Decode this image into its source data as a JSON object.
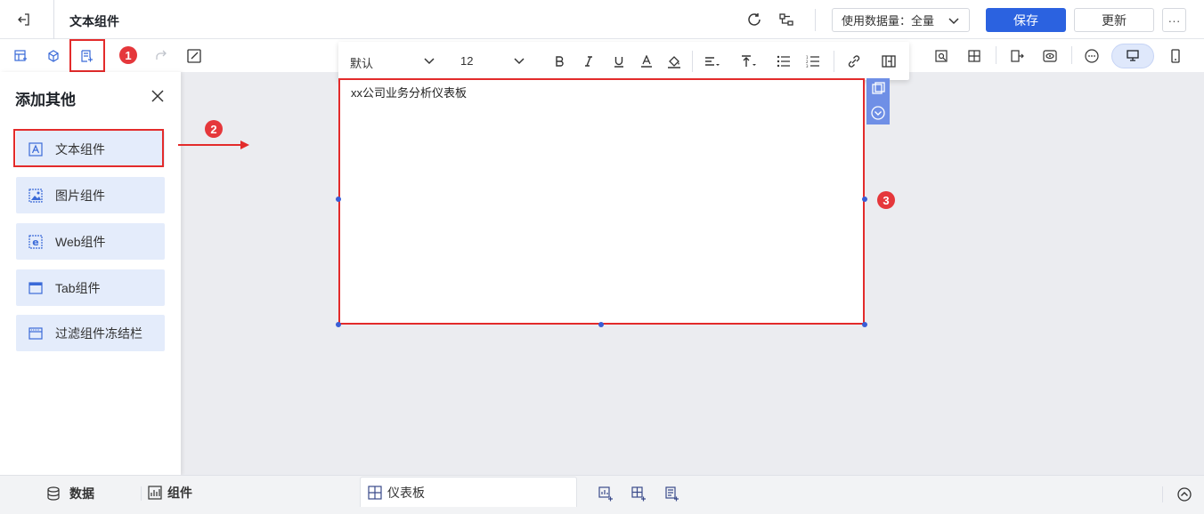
{
  "header": {
    "title": "文本组件",
    "data_select_label": "使用数据量：全量",
    "save_label": "保存",
    "update_label": "更新",
    "more_label": "···"
  },
  "format_bar": {
    "font_family": "默认",
    "font_size": "12"
  },
  "panel": {
    "title": "添加其他",
    "items": [
      {
        "label": "文本组件",
        "icon": "text-component-icon"
      },
      {
        "label": "图片组件",
        "icon": "image-component-icon"
      },
      {
        "label": "Web组件",
        "icon": "web-component-icon"
      },
      {
        "label": "Tab组件",
        "icon": "tab-component-icon"
      },
      {
        "label": "过滤组件冻结栏",
        "icon": "filter-freeze-icon"
      }
    ]
  },
  "canvas": {
    "text": "xx公司业务分析仪表板"
  },
  "steps": [
    "1",
    "2",
    "3"
  ],
  "bottom": {
    "data_label": "数据",
    "component_label": "组件",
    "dashboard_tab": "仪表板"
  },
  "colors": {
    "accent": "#2b62e0",
    "highlight": "#e32b2b",
    "item_bg": "#e4ecfb"
  }
}
